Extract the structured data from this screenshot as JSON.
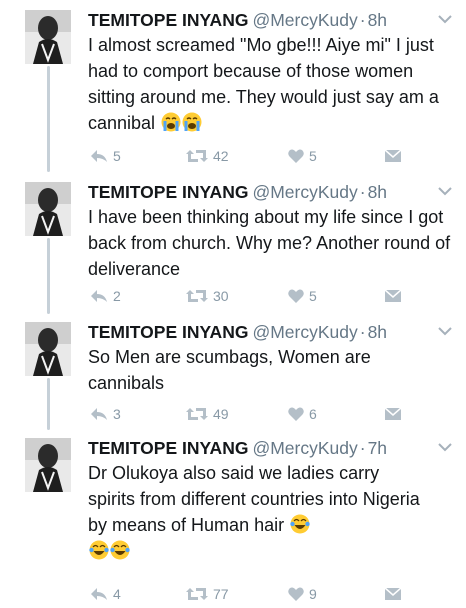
{
  "colors": {
    "text": "#14171a",
    "muted": "#657786",
    "icon": "#8899a6",
    "thread_line": "#c6d0d8"
  },
  "tweets": [
    {
      "name": "TEMITOPE INYANG",
      "handle": "@MercyKudy",
      "time": "8h",
      "text": "I almost screamed \"Mo gbe!!! Aiye mi\" I just had to comport because of those women sitting around me. They would just say am a cannibal",
      "emoji": [
        "crying-face",
        "crying-face"
      ],
      "replies": "5",
      "retweets": "42",
      "likes": "5"
    },
    {
      "name": "TEMITOPE INYANG",
      "handle": "@MercyKudy",
      "time": "8h",
      "text": "I have been thinking about my life since I got back from church. Why me? Another round of deliverance",
      "emoji": [],
      "replies": "2",
      "retweets": "30",
      "likes": "5"
    },
    {
      "name": "TEMITOPE INYANG",
      "handle": "@MercyKudy",
      "time": "8h",
      "text": "So Men are scumbags, Women are cannibals",
      "emoji": [],
      "replies": "3",
      "retweets": "49",
      "likes": "6"
    },
    {
      "name": "TEMITOPE INYANG",
      "handle": "@MercyKudy",
      "time": "7h",
      "text": "Dr Olukoya also said we ladies carry spirits from different countries into Nigeria by means of Human hair",
      "emoji": [
        "tears-of-joy-face",
        "tears-of-joy-face",
        "tears-of-joy-face"
      ],
      "replies": "4",
      "retweets": "77",
      "likes": "9"
    }
  ]
}
